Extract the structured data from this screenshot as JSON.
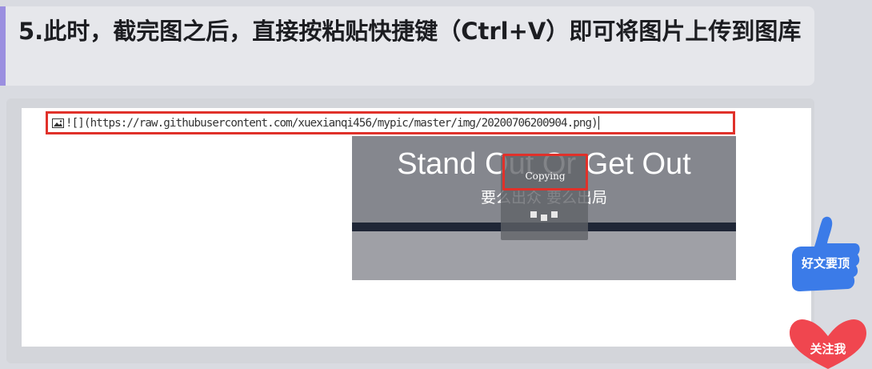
{
  "heading": {
    "text": "5.此时，截完图之后，直接按粘贴快捷键（Ctrl+V）即可将图片上传到图库"
  },
  "editor": {
    "markdown_text": "![](https://raw.githubusercontent.com/xuexianqi456/mypic/master/img/20200706200904.png)"
  },
  "image": {
    "slogan_en": "Stand Out Or Get Out",
    "slogan_cn": "要么出众 要么出局"
  },
  "copy_toast": {
    "label": "Copying"
  },
  "floating_buttons": {
    "like_label": "好文要顶",
    "follow_label": "关注我"
  },
  "icons": {
    "image_placeholder": "image-placeholder-icon",
    "like": "thumbs-up-icon",
    "follow": "heart-icon"
  },
  "colors": {
    "accent_bar": "#9b8fe0",
    "highlight_red": "#e0312a",
    "like_blue": "#3b7be8",
    "follow_red": "#f0464f"
  }
}
